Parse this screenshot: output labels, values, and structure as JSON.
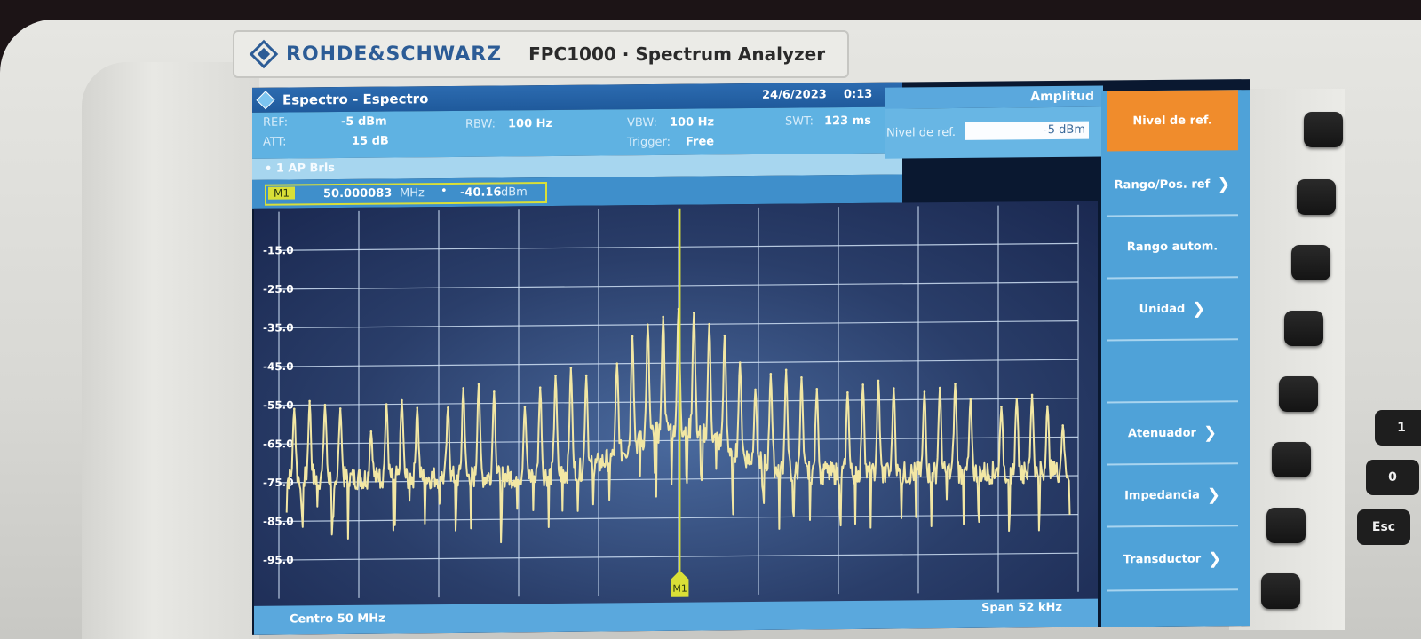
{
  "device": {
    "brand": "ROHDE&SCHWARZ",
    "model": "FPC1000 · Spectrum Analyzer"
  },
  "window": {
    "title": "Espectro - Espectro",
    "date": "24/6/2023",
    "time": "0:13"
  },
  "settings": {
    "ref_label": "REF:",
    "ref_value": "-5 dBm",
    "att_label": "ATT:",
    "att_value": "15 dB",
    "rbw_label": "RBW:",
    "rbw_value": "100 Hz",
    "vbw_label": "VBW:",
    "vbw_value": "100 Hz",
    "trigger_label": "Trigger:",
    "trigger_value": "Free",
    "swt_label": "SWT:",
    "swt_value": "123 ms"
  },
  "trace": {
    "label": "• 1 AP Brls"
  },
  "marker": {
    "name": "M1",
    "frequency": "50.000083",
    "frequency_unit": "MHz",
    "separator": "•",
    "level": "-40.16",
    "level_unit": "dBm"
  },
  "amplitude_panel": {
    "header": "Amplitud",
    "ref_label": "Nivel de ref.",
    "ref_value": "-5 dBm"
  },
  "softkeys": [
    {
      "label": "Nivel de ref.",
      "chevron": "",
      "active": true
    },
    {
      "label": "Rango/Pos. ref",
      "chevron": "❯",
      "active": false
    },
    {
      "label": "Rango autom.",
      "chevron": "",
      "active": false
    },
    {
      "label": "Unidad",
      "chevron": "❯",
      "active": false
    },
    {
      "label": "",
      "chevron": "",
      "active": false
    },
    {
      "label": "Atenuador",
      "chevron": "❯",
      "active": false
    },
    {
      "label": "Impedancia",
      "chevron": "❯",
      "active": false
    },
    {
      "label": "Transductor",
      "chevron": "❯",
      "active": false
    }
  ],
  "footer": {
    "center": "Centro 50 MHz",
    "span": "Span 52 kHz"
  },
  "keypad": {
    "keys": [
      "1",
      "0",
      "Esc"
    ]
  },
  "colors": {
    "trace": "#f2e7a4",
    "marker": "#d9df37",
    "active_softkey": "#f08c2c",
    "brand": "#2c5c96"
  },
  "chart_data": {
    "type": "line",
    "title": "",
    "xlabel": "Centro 50 MHz",
    "ylabel": "",
    "span_label": "Span 52 kHz",
    "x_unit": "kHz offset from 50 MHz",
    "xlim": [
      -26,
      26
    ],
    "ylim": [
      -105,
      -5
    ],
    "y_ticks": [
      "-15.0",
      "-25.0",
      "-35.0",
      "-45.0",
      "-55.0",
      "-65.0",
      "-75.0",
      "-85.0",
      "-95.0"
    ],
    "grid": true,
    "marker": {
      "name": "M1",
      "x": 0.083,
      "y": -40.16
    },
    "series": [
      {
        "spur_spacing_khz": 1,
        "peaks": [
          {
            "x": -25,
            "y": -56
          },
          {
            "x": -24,
            "y": -54
          },
          {
            "x": -23,
            "y": -55
          },
          {
            "x": -22,
            "y": -56
          },
          {
            "x": -20,
            "y": -62
          },
          {
            "x": -19,
            "y": -55
          },
          {
            "x": -18,
            "y": -54
          },
          {
            "x": -17,
            "y": -56
          },
          {
            "x": -15,
            "y": -56
          },
          {
            "x": -14,
            "y": -51
          },
          {
            "x": -13,
            "y": -50
          },
          {
            "x": -12,
            "y": -52
          },
          {
            "x": -10,
            "y": -56
          },
          {
            "x": -9,
            "y": -51
          },
          {
            "x": -8,
            "y": -48
          },
          {
            "x": -7,
            "y": -46
          },
          {
            "x": -6,
            "y": -48
          },
          {
            "x": -4,
            "y": -45
          },
          {
            "x": -3,
            "y": -38
          },
          {
            "x": -2,
            "y": -35
          },
          {
            "x": -1,
            "y": -33
          },
          {
            "x": 0,
            "y": -31
          },
          {
            "x": 1,
            "y": -32
          },
          {
            "x": 2,
            "y": -35
          },
          {
            "x": 3,
            "y": -38
          },
          {
            "x": 4,
            "y": -45
          },
          {
            "x": 5,
            "y": -52
          },
          {
            "x": 6,
            "y": -48
          },
          {
            "x": 7,
            "y": -47
          },
          {
            "x": 8,
            "y": -49
          },
          {
            "x": 9,
            "y": -52
          },
          {
            "x": 11,
            "y": -53
          },
          {
            "x": 12,
            "y": -51
          },
          {
            "x": 13,
            "y": -50
          },
          {
            "x": 14,
            "y": -52
          },
          {
            "x": 16,
            "y": -53
          },
          {
            "x": 17,
            "y": -52
          },
          {
            "x": 18,
            "y": -51
          },
          {
            "x": 19,
            "y": -55
          },
          {
            "x": 21,
            "y": -57
          },
          {
            "x": 22,
            "y": -55
          },
          {
            "x": 23,
            "y": -54
          },
          {
            "x": 24,
            "y": -57
          },
          {
            "x": 25,
            "y": -62
          }
        ],
        "floor_level": -72
      }
    ]
  }
}
